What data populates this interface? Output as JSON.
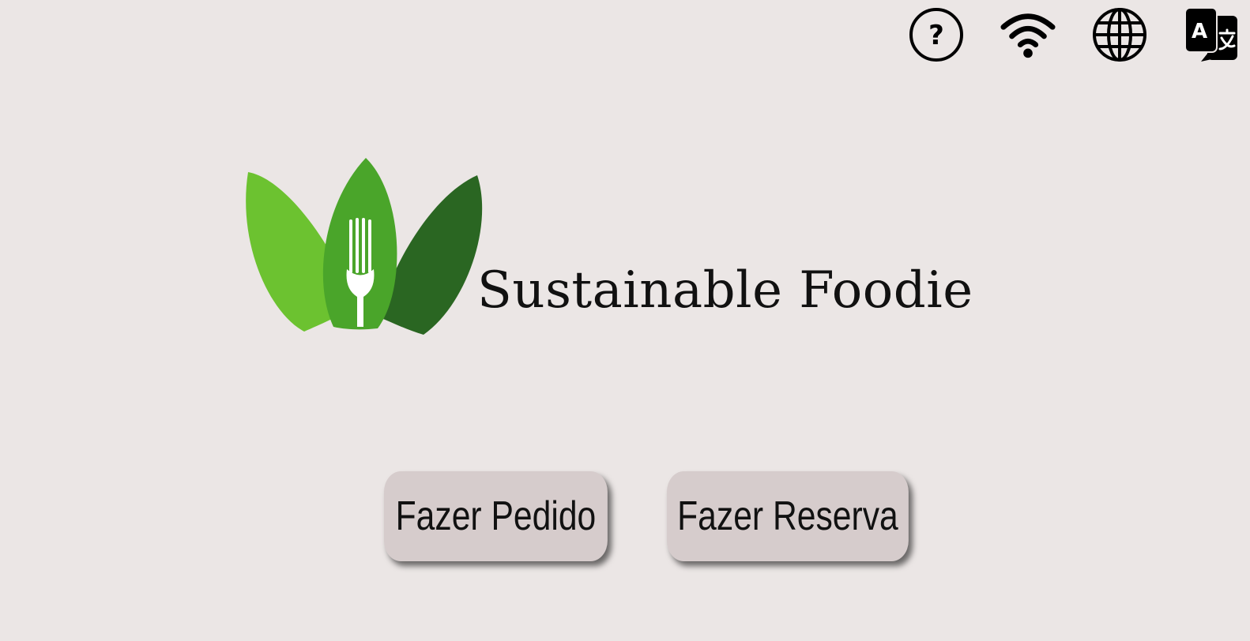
{
  "topbar": {
    "icons": [
      {
        "name": "help-icon",
        "label": "?"
      },
      {
        "name": "wifi-icon"
      },
      {
        "name": "globe-icon"
      },
      {
        "name": "translate-icon"
      }
    ]
  },
  "brand": {
    "title": "Sustainable Foodie",
    "colors": {
      "leaf_light": "#6cc230",
      "leaf_mid": "#4aa52a",
      "leaf_dark": "#2a6622"
    }
  },
  "actions": {
    "order_label": "Fazer Pedido",
    "reserve_label": "Fazer Reserva"
  },
  "theme": {
    "background": "#ebe6e5",
    "button_bg": "#d6cccc"
  }
}
